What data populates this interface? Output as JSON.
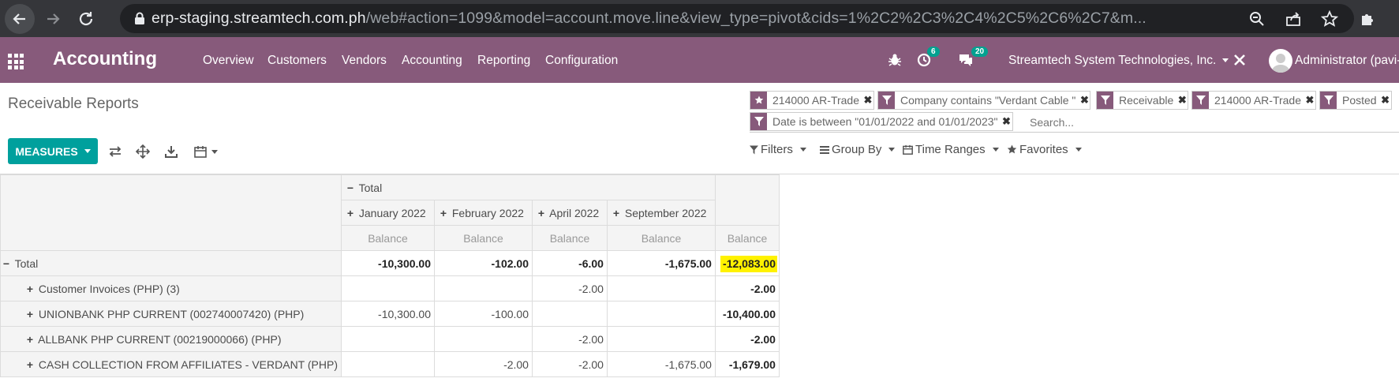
{
  "browser": {
    "url_host": "erp-staging.streamtech.com.ph",
    "url_path": "/web#action=1099&model=account.move.line&view_type=pivot&cids=1%2C2%2C3%2C4%2C5%2C6%2C7&m..."
  },
  "navbar": {
    "brand": "Accounting",
    "menu": [
      "Overview",
      "Customers",
      "Vendors",
      "Accounting",
      "Reporting",
      "Configuration"
    ],
    "activity_count": "6",
    "messages_count": "20",
    "company": "Streamtech System Technologies, Inc.",
    "user": "Administrator (pavi-p"
  },
  "control_panel": {
    "breadcrumb": "Receivable Reports",
    "facets": [
      {
        "type": "favorite",
        "label": "214000 AR-Trade"
      },
      {
        "type": "filter",
        "label": "Company contains \"Verdant Cable \""
      },
      {
        "type": "filter",
        "label": "Receivable"
      },
      {
        "type": "filter",
        "label": "214000 AR-Trade"
      },
      {
        "type": "filter",
        "label": "Posted"
      },
      {
        "type": "filter",
        "label": "Date is between \"01/01/2022 and 01/01/2023\""
      }
    ],
    "search_placeholder": "Search...",
    "measures_label": "MEASURES",
    "filters_label": "Filters",
    "groupby_label": "Group By",
    "timeranges_label": "Time Ranges",
    "favorites_label": "Favorites"
  },
  "pivot": {
    "col_total": "Total",
    "columns": [
      "January 2022",
      "February 2022",
      "April 2022",
      "September 2022"
    ],
    "measure": "Balance",
    "total_label": "Total",
    "total_row": [
      "-10,300.00",
      "-102.00",
      "-6.00",
      "-1,675.00",
      "-12,083.00"
    ],
    "rows": [
      {
        "label": "Customer Invoices (PHP) (3)",
        "values": [
          "",
          "",
          "-2.00",
          "",
          "-2.00"
        ]
      },
      {
        "label": "UNIONBANK PHP CURRENT (002740007420) (PHP)",
        "values": [
          "-10,300.00",
          "-100.00",
          "",
          "",
          "-10,400.00"
        ]
      },
      {
        "label": "ALLBANK PHP CURRENT (00219000066) (PHP)",
        "values": [
          "",
          "",
          "-2.00",
          "",
          "-2.00"
        ]
      },
      {
        "label": "CASH COLLECTION FROM AFFILIATES - VERDANT (PHP)",
        "values": [
          "",
          "-2.00",
          "-2.00",
          "-1,675.00",
          "-1,679.00"
        ]
      }
    ]
  },
  "colors": {
    "navbar": "#875a7b",
    "primary_button": "#00a09d",
    "highlight": "#fff200"
  }
}
